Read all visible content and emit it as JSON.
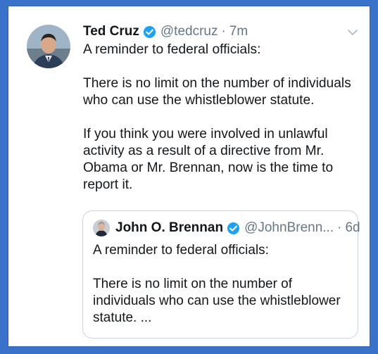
{
  "tweet": {
    "author_name": "Ted Cruz",
    "handle": "@tedcruz",
    "separator": "·",
    "time": "7m",
    "text": "A reminder to federal officials:\n\nThere is no limit on the number of individuals who can use the whistleblower statute.\n\nIf you think you were involved in unlawful activity as a result of a directive from Mr. Obama or Mr. Brennan, now is the time to report it."
  },
  "quoted_tweet": {
    "author_name": "John O. Brennan",
    "handle": "@JohnBrenn...",
    "separator": "·",
    "time": "6d",
    "text": "A reminder to federal officials:\n\nThere is no limit on the number of individuals who can use the whistleblower statute. ..."
  },
  "colors": {
    "background": "#3b72c9",
    "verified": "#1da1f2",
    "secondary_text": "#657786",
    "border": "#c9d3db"
  },
  "icons": {
    "verified": "verified-badge-icon",
    "menu": "chevron-down-icon"
  }
}
